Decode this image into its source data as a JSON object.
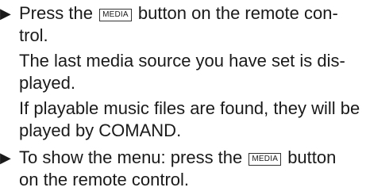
{
  "steps": [
    {
      "bullet": "▶",
      "line1_before": "Press the",
      "key": "MEDIA",
      "line1_after": "button on the remote con-",
      "line2": "trol."
    },
    {
      "bullet": "▶",
      "line1_before": "To show the menu: press the",
      "key": "MEDIA",
      "line1_after": "button",
      "line2": "on the remote control."
    }
  ],
  "results": [
    {
      "line1": "The last media source you have set is dis-",
      "line2": "played."
    },
    {
      "line1": "If playable music files are found, they will be",
      "line2": "played by COMAND."
    }
  ]
}
